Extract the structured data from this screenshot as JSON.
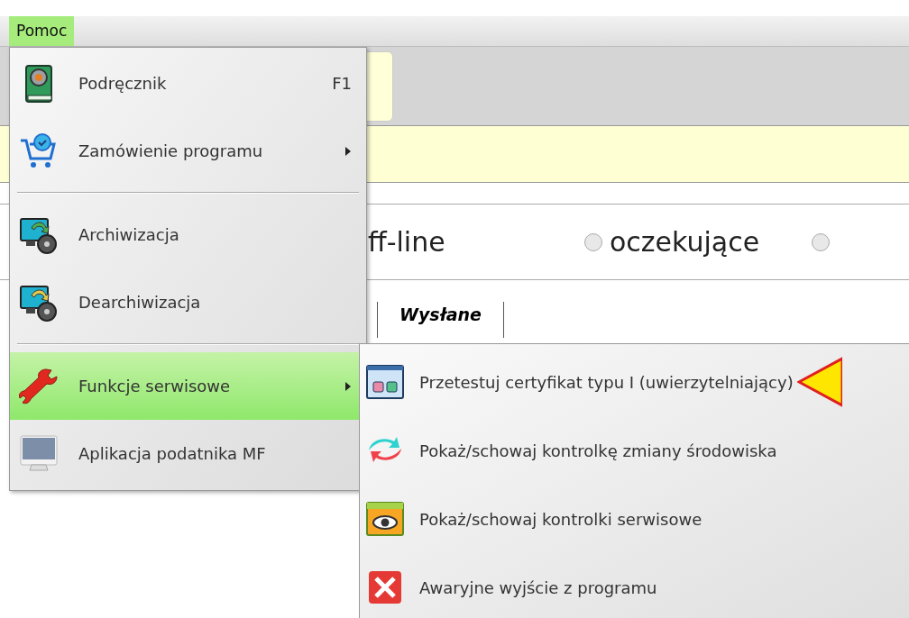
{
  "menu_bar": [
    {
      "label": "Pomoc",
      "selected": true
    }
  ],
  "background": {
    "radios": [
      {
        "label": "ff-line",
        "selected": false,
        "kind": "cut"
      },
      {
        "label": "oczekujące",
        "selected": false,
        "kind": "radio"
      },
      {
        "selected": false,
        "kind": "edge"
      }
    ],
    "table_header": "Wysłane"
  },
  "menu": [
    {
      "kind": "item",
      "label": "Podręcznik",
      "shortcut": "F1",
      "submenu": false,
      "selected": false
    },
    {
      "kind": "item",
      "label": "Zamówienie programu",
      "submenu": true,
      "selected": false
    },
    {
      "kind": "separator"
    },
    {
      "kind": "item",
      "label": "Archiwizacja",
      "submenu": false,
      "selected": false
    },
    {
      "kind": "item",
      "label": "Dearchiwizacja",
      "submenu": false,
      "selected": false
    },
    {
      "kind": "separator"
    },
    {
      "kind": "item",
      "label": "Funkcje serwisowe",
      "submenu": true,
      "selected": true
    },
    {
      "kind": "item",
      "label": "Aplikacja podatnika MF",
      "submenu": false,
      "selected": false
    }
  ],
  "submenu": [
    {
      "label": "Przetestuj certyfikat typu I (uwierzytelniający)",
      "pointer": true
    },
    {
      "label": "Pokaż/schowaj kontrolkę zmiany środowiska",
      "pointer": false
    },
    {
      "label": "Pokaż/schowaj kontrolki serwisowe",
      "pointer": false
    },
    {
      "label": "Awaryjne wyjście z programu",
      "pointer": false
    }
  ]
}
